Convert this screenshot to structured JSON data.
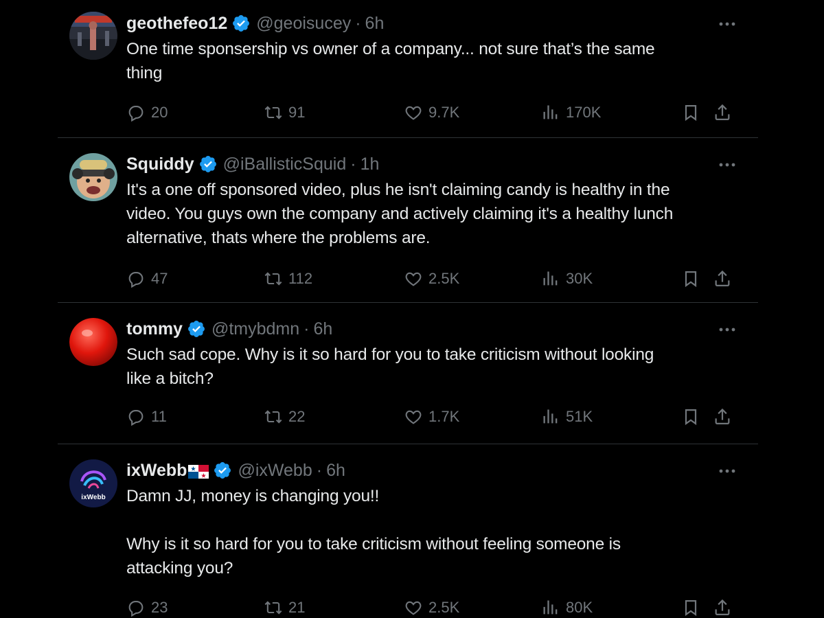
{
  "tweets": [
    {
      "name": "geothefeo12",
      "handle": "@geoisucey",
      "dot": "·",
      "time": "6h",
      "text": "One time sponsership vs owner of a company... not sure that’s the same\nthing",
      "replies": "20",
      "retweets": "91",
      "likes": "9.7K",
      "views": "170K"
    },
    {
      "name": "Squiddy",
      "handle": "@iBallisticSquid",
      "dot": "·",
      "time": "1h",
      "text": "It's a one off sponsored video, plus he isn't claiming candy is healthy in the\nvideo. You guys own the company and actively claiming it's a healthy lunch\nalternative, thats where the problems are.",
      "replies": "47",
      "retweets": "112",
      "likes": "2.5K",
      "views": "30K"
    },
    {
      "name": "tommy",
      "handle": "@tmybdmn",
      "dot": "·",
      "time": "6h",
      "text": "Such sad cope. Why is it so hard for you to take criticism without looking\nlike a bitch?",
      "replies": "11",
      "retweets": "22",
      "likes": "1.7K",
      "views": "51K"
    },
    {
      "name": "ixWebb",
      "avatar_label": "ixWebb",
      "handle": "@ixWebb",
      "dot": "·",
      "time": "6h",
      "text": "Damn JJ, money is changing you!!\n\nWhy is it so hard for you to take criticism without feeling someone is\nattacking you?",
      "replies": "23",
      "retweets": "21",
      "likes": "2.5K",
      "views": "80K"
    }
  ],
  "colors": {
    "background": "#000000",
    "text": "#e7e9ea",
    "secondary": "#71767b",
    "divider": "#2f3336",
    "verified": "#1d9bf0"
  },
  "icons": [
    "more-icon",
    "verified-icon",
    "reply-icon",
    "retweet-icon",
    "like-icon",
    "views-icon",
    "bookmark-icon",
    "share-icon",
    "panama-flag-icon"
  ]
}
